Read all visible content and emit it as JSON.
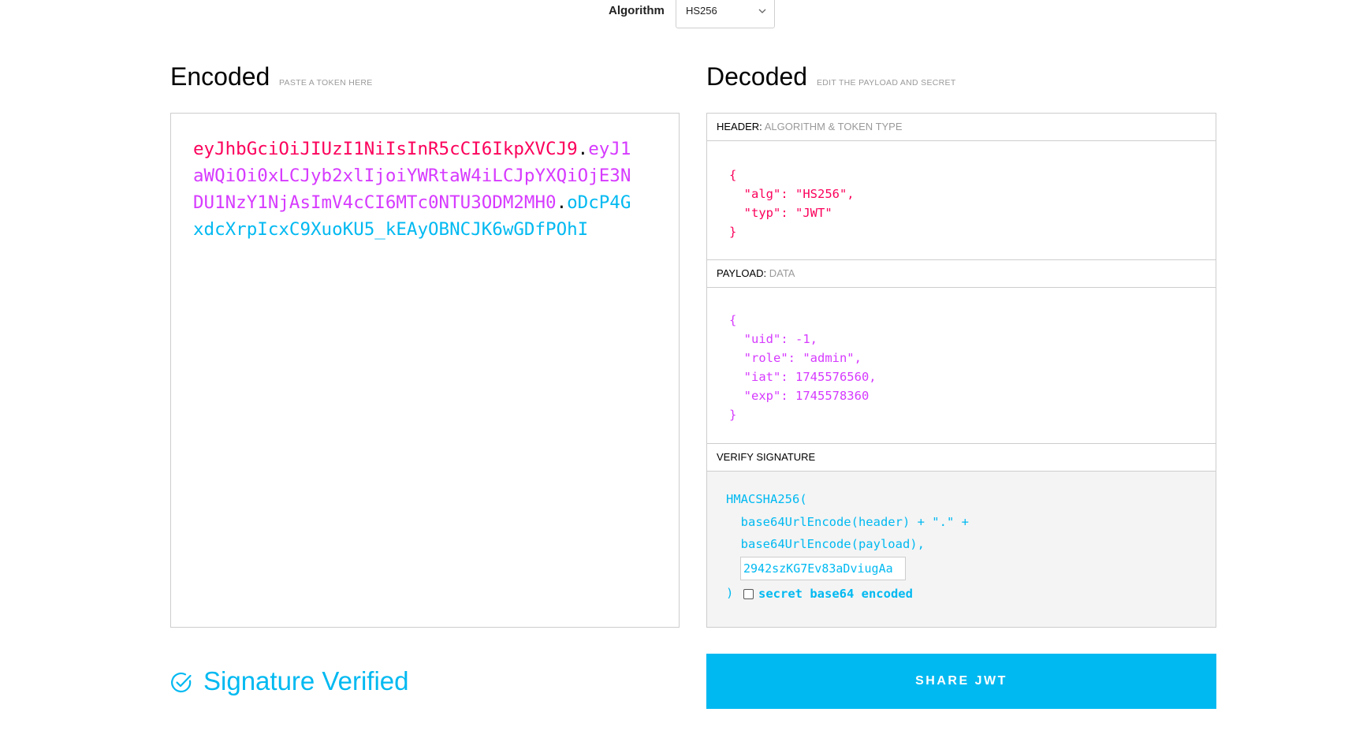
{
  "algorithm": {
    "label": "Algorithm",
    "selected": "HS256"
  },
  "encoded": {
    "title": "Encoded",
    "subtitle": "PASTE A TOKEN HERE",
    "token_header": "eyJhbGciOiJIUzI1NiIsInR5cCI6IkpXVCJ9",
    "token_payload": "eyJ1aWQiOi0xLCJyb2xlIjoiYWRtaW4iLCJpYXQiOjE3NDU1NzY1NjAsImV4cCI6MTc0NTU3ODM2MH0",
    "token_signature": "oDcP4GxdcXrpIcxC9XuoKU5_kEAyOBNCJK6wGDfPOhI",
    "dot": "."
  },
  "decoded": {
    "title": "Decoded",
    "subtitle": "EDIT THE PAYLOAD AND SECRET",
    "header_section": {
      "label": "HEADER:",
      "sublabel": "ALGORITHM & TOKEN TYPE",
      "lines": [
        "{",
        "  \"alg\": \"HS256\",",
        "  \"typ\": \"JWT\"",
        "}"
      ]
    },
    "payload_section": {
      "label": "PAYLOAD:",
      "sublabel": "DATA",
      "lines": [
        "{",
        "  \"uid\": -1,",
        "  \"role\": \"admin\",",
        "  \"iat\": 1745576560,",
        "  \"exp\": 1745578360",
        "}"
      ]
    },
    "verify_section": {
      "label": "VERIFY SIGNATURE",
      "line1": "HMACSHA256(",
      "line2": "  base64UrlEncode(header) + \".\" +",
      "line3": "  base64UrlEncode(payload),",
      "secret_value": "2942szKG7Ev83aDviugAa",
      "close_paren": ")",
      "base64_label": "secret base64 encoded",
      "base64_checked": false
    }
  },
  "signature_status": "Signature Verified",
  "share_label": "SHARE JWT",
  "colors": {
    "header": "#fb015b",
    "payload": "#d63aff",
    "signature": "#00b9f1",
    "accent": "#00b9f1"
  }
}
